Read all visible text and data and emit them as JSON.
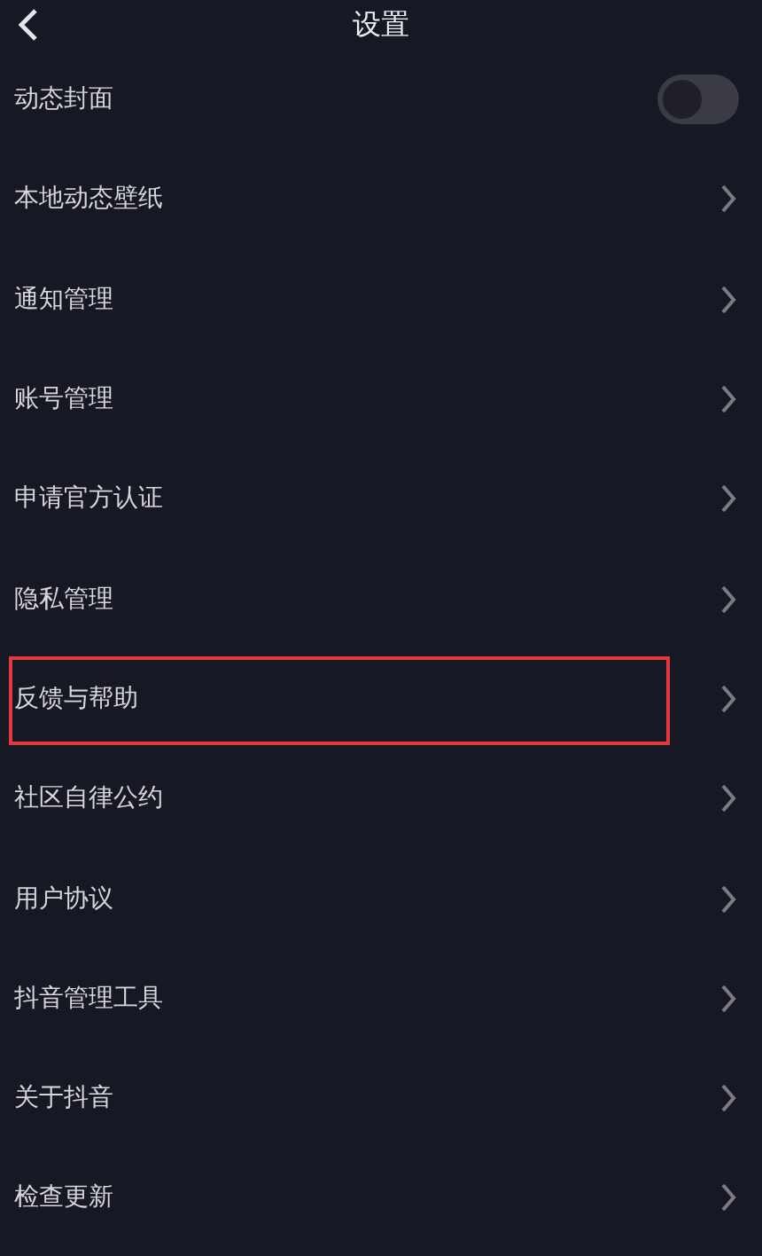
{
  "header": {
    "title": "设置"
  },
  "items": [
    {
      "label": "动态封面",
      "kind": "toggle",
      "on": false,
      "highlighted": false
    },
    {
      "label": "本地动态壁纸",
      "kind": "link",
      "highlighted": false
    },
    {
      "label": "通知管理",
      "kind": "link",
      "highlighted": false
    },
    {
      "label": "账号管理",
      "kind": "link",
      "highlighted": false
    },
    {
      "label": "申请官方认证",
      "kind": "link",
      "highlighted": false
    },
    {
      "label": "隐私管理",
      "kind": "link",
      "highlighted": false
    },
    {
      "label": "反馈与帮助",
      "kind": "link",
      "highlighted": true
    },
    {
      "label": "社区自律公约",
      "kind": "link",
      "highlighted": false
    },
    {
      "label": "用户协议",
      "kind": "link",
      "highlighted": false
    },
    {
      "label": "抖音管理工具",
      "kind": "link",
      "highlighted": false
    },
    {
      "label": "关于抖音",
      "kind": "link",
      "highlighted": false
    },
    {
      "label": "检查更新",
      "kind": "link",
      "highlighted": false
    }
  ]
}
